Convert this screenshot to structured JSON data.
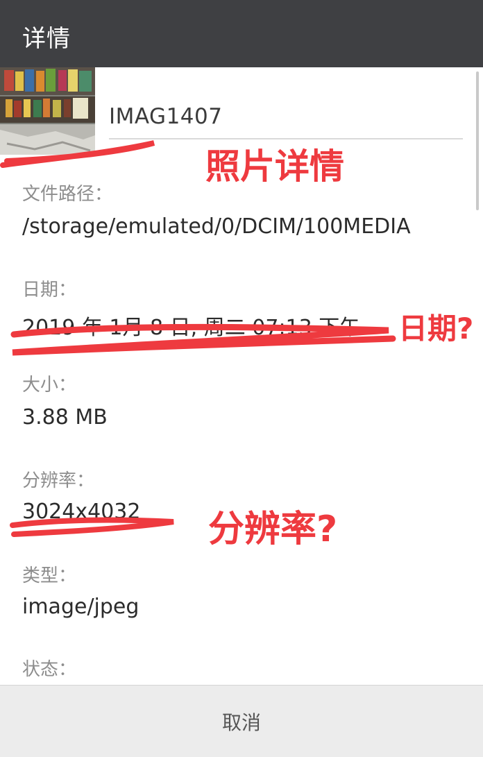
{
  "dialog": {
    "title": "详情"
  },
  "photo": {
    "filename": "IMAG1407"
  },
  "details": [
    {
      "label": "文件路径：",
      "value": "/storage/emulated/0/DCIM/100MEDIA"
    },
    {
      "label": "日期：",
      "value": "2019 年 1月 8 日, 周二 07:13 下午"
    },
    {
      "label": "大小：",
      "value": "3.88 MB"
    },
    {
      "label": "分辨率：",
      "value": "3024x4032"
    },
    {
      "label": "类型：",
      "value": "image/jpeg"
    },
    {
      "label": "状态："
    }
  ],
  "footer": {
    "cancel_label": "取消"
  },
  "annotations": {
    "photo_details": "照片详情",
    "date": "日期?",
    "resolution": "分辨率?"
  },
  "colors": {
    "annotation": "#ee3a3f",
    "titlebar": "#3f4043"
  }
}
